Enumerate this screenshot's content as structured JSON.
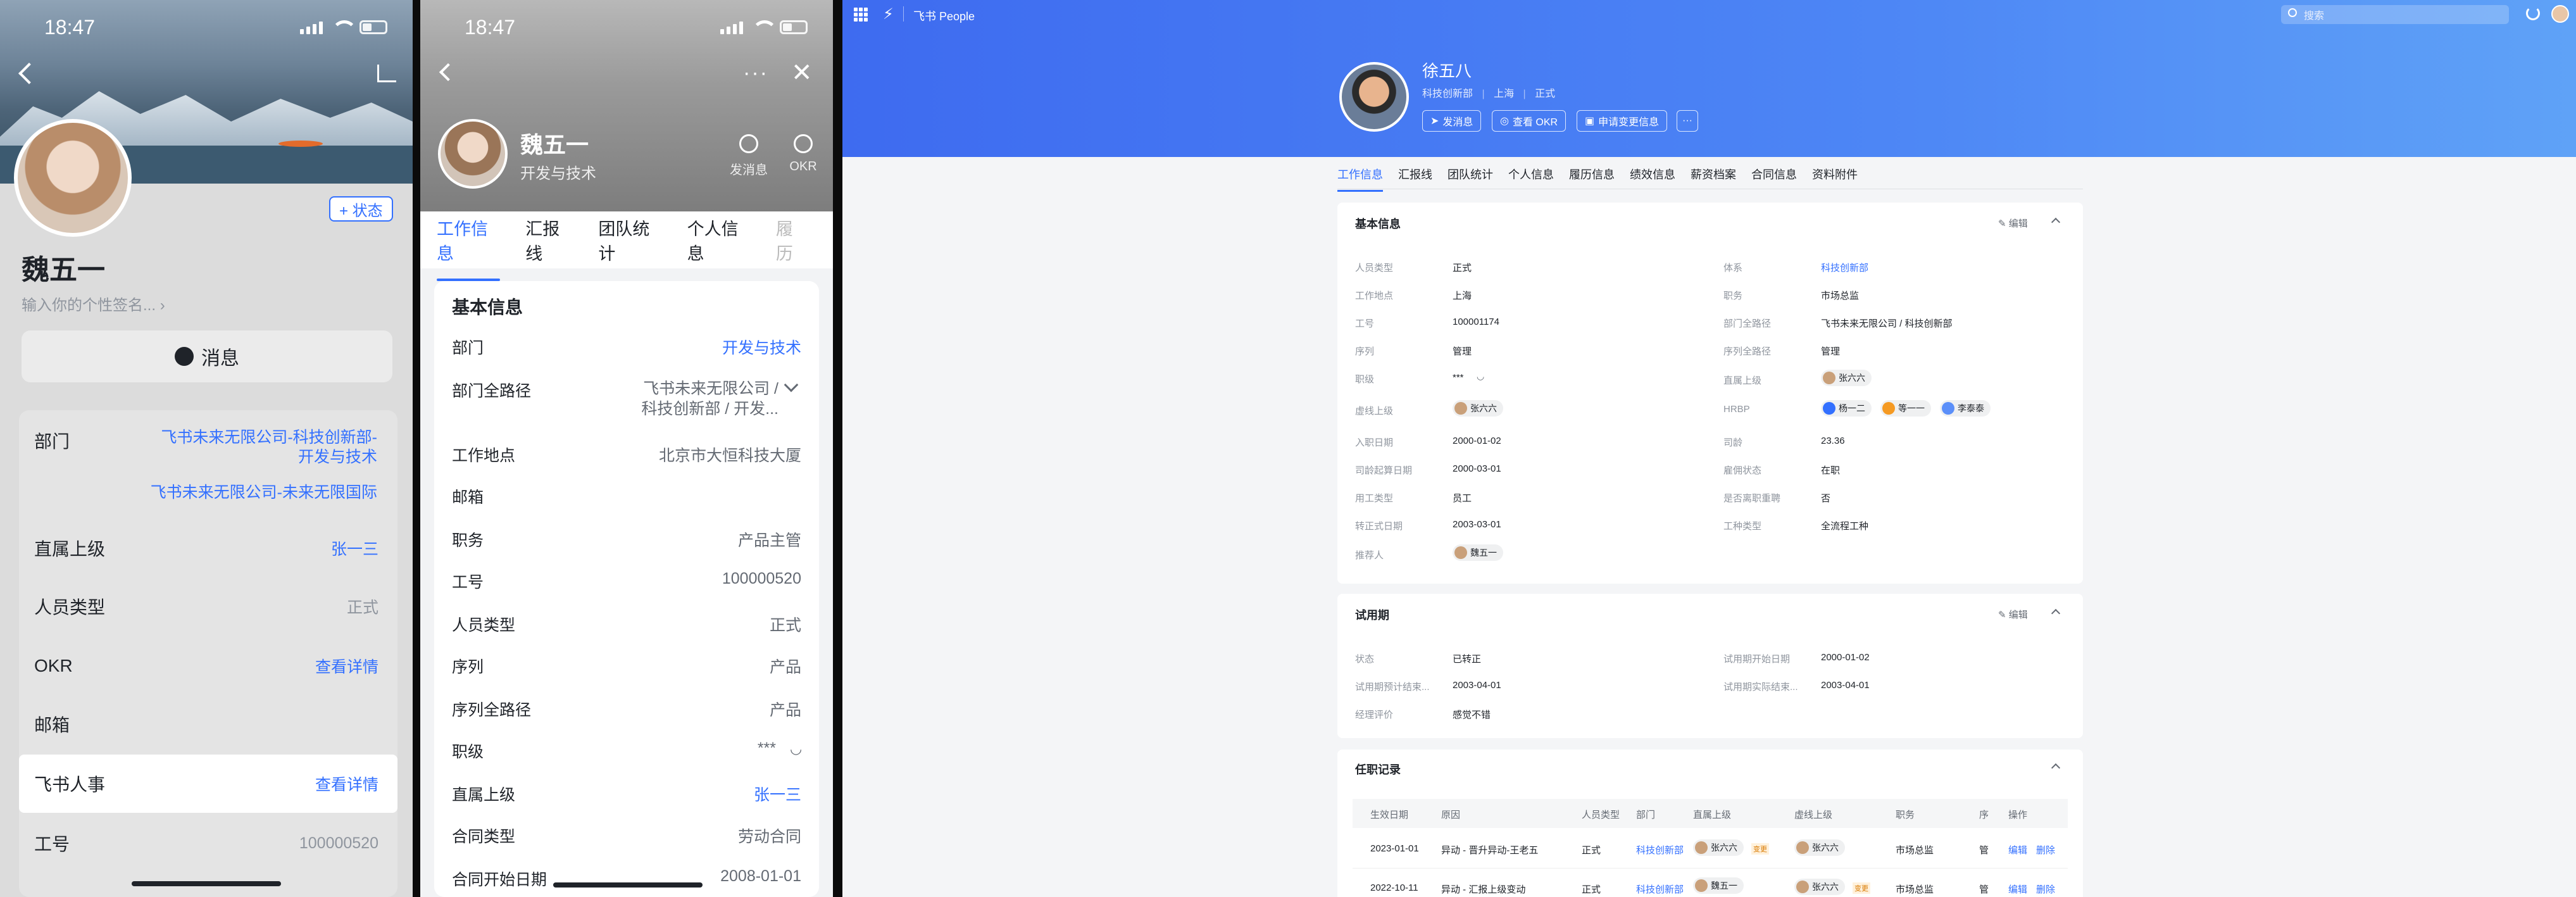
{
  "phone1": {
    "time": "18:47",
    "name": "魏五一",
    "signature": "输入你的个性签名...",
    "state_button": "+ 状态",
    "message_button": "消息",
    "rows": [
      {
        "label": "部门",
        "value": "飞书未来无限公司-科技创新部-开发与技术",
        "value2": "飞书未来无限公司-未来无限国际",
        "link": true
      },
      {
        "label": "直属上级",
        "value": "张一三",
        "link": true
      },
      {
        "label": "人员类型",
        "value": "正式",
        "link": false
      },
      {
        "label": "OKR",
        "value": "查看详情",
        "link": true
      },
      {
        "label": "邮箱",
        "value": "",
        "link": false
      },
      {
        "label": "飞书人事",
        "value": "查看详情",
        "link": true
      },
      {
        "label": "工号",
        "value": "100000520",
        "link": false
      }
    ]
  },
  "phone2": {
    "time": "18:47",
    "name": "魏五一",
    "dept": "开发与技术",
    "actions": [
      "发消息",
      "OKR"
    ],
    "tabs": [
      "工作信息",
      "汇报线",
      "团队统计",
      "个人信息",
      "履历"
    ],
    "section": "基本信息",
    "rows": [
      {
        "label": "部门",
        "value": "开发与技术",
        "link": true
      },
      {
        "label": "部门全路径",
        "value": "飞书未来无限公司 /",
        "value2": "科技创新部 / 开发...",
        "link": false
      },
      {
        "label": "工作地点",
        "value": "北京市大恒科技大厦",
        "link": false
      },
      {
        "label": "邮箱",
        "value": "",
        "link": false
      },
      {
        "label": "职务",
        "value": "产品主管",
        "link": false
      },
      {
        "label": "工号",
        "value": "100000520",
        "link": false
      },
      {
        "label": "人员类型",
        "value": "正式",
        "link": false
      },
      {
        "label": "序列",
        "value": "产品",
        "link": false
      },
      {
        "label": "序列全路径",
        "value": "产品",
        "link": false
      },
      {
        "label": "职级",
        "value": "***",
        "link": false
      },
      {
        "label": "直属上级",
        "value": "张一三",
        "link": true
      },
      {
        "label": "合同类型",
        "value": "劳动合同",
        "link": false
      },
      {
        "label": "合同开始日期",
        "value": "2008-01-01",
        "link": false
      }
    ]
  },
  "web": {
    "app_name": "飞书 People",
    "search_placeholder": "搜索",
    "name": "徐五八",
    "sub": [
      "科技创新部",
      "上海",
      "正式"
    ],
    "buttons": [
      "发消息",
      "查看 OKR",
      "申请变更信息",
      "···"
    ],
    "tabs": [
      "工作信息",
      "汇报线",
      "团队统计",
      "个人信息",
      "履历信息",
      "绩效信息",
      "薪资档案",
      "合同信息",
      "资料附件"
    ],
    "edit_label": "编辑",
    "basic": {
      "title": "基本信息",
      "left": [
        {
          "k": "人员类型",
          "v": "正式"
        },
        {
          "k": "工作地点",
          "v": "上海"
        },
        {
          "k": "工号",
          "v": "100001174"
        },
        {
          "k": "序列",
          "v": "管理"
        },
        {
          "k": "职级",
          "v": "***"
        },
        {
          "k": "虚线上级",
          "v": "张六六",
          "chip": true
        },
        {
          "k": "入职日期",
          "v": "2000-01-02"
        },
        {
          "k": "司龄起算日期",
          "v": "2000-03-01"
        },
        {
          "k": "用工类型",
          "v": "员工"
        },
        {
          "k": "转正式日期",
          "v": "2003-03-01"
        },
        {
          "k": "推荐人",
          "v": "魏五一",
          "chip": true
        }
      ],
      "right": [
        {
          "k": "体系",
          "v": "科技创新部",
          "link": true
        },
        {
          "k": "职务",
          "v": "市场总监"
        },
        {
          "k": "部门全路径",
          "v": "飞书未来无限公司 / 科技创新部"
        },
        {
          "k": "序列全路径",
          "v": "管理"
        },
        {
          "k": "直属上级",
          "v": "张六六",
          "chip": true
        },
        {
          "k": "HRBP",
          "chips": [
            "杨一二",
            "等一一",
            "李泰泰"
          ]
        },
        {
          "k": "司龄",
          "v": "23.36"
        },
        {
          "k": "雇佣状态",
          "v": "在职"
        },
        {
          "k": "是否离职重聘",
          "v": "否"
        },
        {
          "k": "工种类型",
          "v": "全流程工种"
        }
      ]
    },
    "probation": {
      "title": "试用期",
      "left": [
        {
          "k": "状态",
          "v": "已转正"
        },
        {
          "k": "试用期预计结束...",
          "v": "2003-04-01"
        },
        {
          "k": "经理评价",
          "v": "感觉不错"
        }
      ],
      "right": [
        {
          "k": "试用期开始日期",
          "v": "2000-01-02"
        },
        {
          "k": "试用期实际结束...",
          "v": "2003-04-01"
        }
      ]
    },
    "history": {
      "title": "任职记录",
      "columns": [
        "生效日期",
        "原因",
        "人员类型",
        "部门",
        "直属上级",
        "虚线上级",
        "职务",
        "序",
        "操作"
      ],
      "rows": [
        {
          "date": "2023-01-01",
          "reason": "异动 - 晋升异动-王老五",
          "type": "正式",
          "dept": "科技创新部",
          "boss": "张六六",
          "tag": "变更",
          "dboss": "张六六",
          "title": "市场总监",
          "seq": "管",
          "ops": [
            "编辑",
            "删除"
          ]
        },
        {
          "date": "2022-10-11",
          "reason": "异动 - 汇报上级变动",
          "type": "正式",
          "dept": "科技创新部",
          "boss": "魏五一",
          "tag": "",
          "dboss": "张六六",
          "title": "市场总监",
          "seq": "管",
          "ops": [
            "编辑",
            "删除"
          ],
          "tag2": "变更"
        }
      ]
    }
  }
}
